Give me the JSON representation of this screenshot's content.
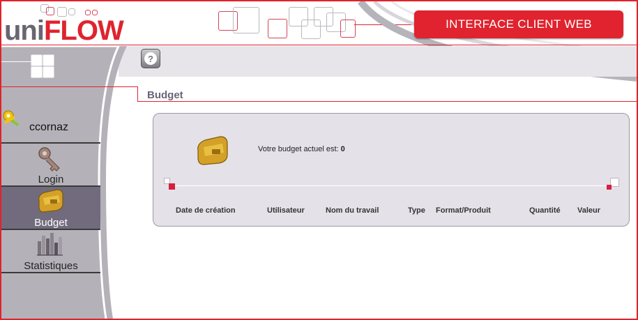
{
  "header": {
    "logo_uni": "uni",
    "logo_flow": "FLOW",
    "banner": "INTERFACE CLIENT WEB"
  },
  "toolbar": {
    "help_icon": "help-icon",
    "help_glyph": "?"
  },
  "user": {
    "name": "ccornaz",
    "icon": "keys-icon"
  },
  "nav": {
    "items": [
      {
        "label": "Login",
        "icon": "key-icon",
        "active": false
      },
      {
        "label": "Budget",
        "icon": "wallet-icon",
        "active": true
      },
      {
        "label": "Statistiques",
        "icon": "bar-chart-icon",
        "active": false
      }
    ]
  },
  "page": {
    "title": "Budget"
  },
  "budget": {
    "label": "Votre budget actuel est:",
    "value": "0",
    "columns": [
      "Date de création",
      "Utilisateur",
      "Nom du travail",
      "Type",
      "Format/Produit",
      "Quantité",
      "Valeur"
    ]
  },
  "colors": {
    "accent": "#e0232e",
    "nav_active": "#716b7d",
    "panel": "#e4e2e8"
  }
}
